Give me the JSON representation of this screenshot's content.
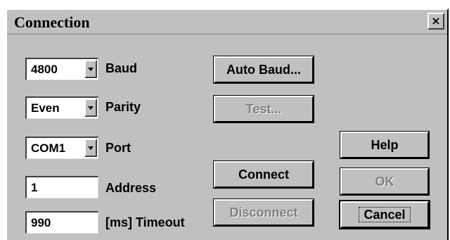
{
  "window": {
    "title": "Connection",
    "close_label": "×"
  },
  "settings": {
    "baud": {
      "value": "4800",
      "label": "Baud"
    },
    "parity": {
      "value": "Even",
      "label": "Parity"
    },
    "port": {
      "value": "COM1",
      "label": "Port"
    },
    "address": {
      "value": "1",
      "label": "Address"
    },
    "timeout": {
      "value": "990",
      "label": "[ms] Timeout"
    }
  },
  "buttons": {
    "auto_baud": "Auto Baud...",
    "test": "Test...",
    "connect": "Connect",
    "disconnect": "Disconnect",
    "help": "Help",
    "ok": "OK",
    "cancel": "Cancel"
  }
}
